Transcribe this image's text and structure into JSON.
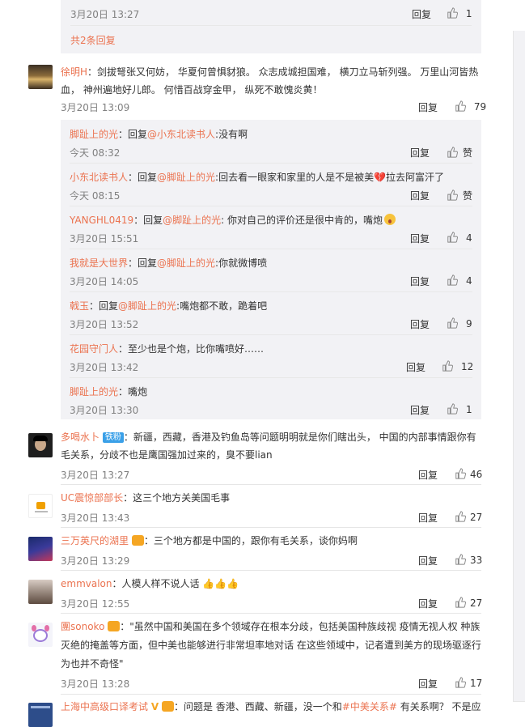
{
  "reply_label": "回复",
  "top_nested": {
    "time": "3月20日 13:27",
    "likes": "1",
    "total_replies": "共2条回复"
  },
  "comments": [
    {
      "name": "徐明H",
      "text": "：剑拔弩张又何妨， 华夏何曾惧豺狼。 众志成城担国难， 横刀立马斩列强。 万里山河皆热血， 神州遍地好儿郎。 何惜百战穿金甲， 纵死不敢愧炎黄！",
      "time": "3月20日 13:09",
      "likes": "79"
    },
    {
      "name": "多喝水卜",
      "badge": "铁粉",
      "text": "：新疆，西藏，香港及钓鱼岛等问题明明就是你们瞎出头， 中国的内部事情跟你有毛关系，分歧不也是鹰国强加过来的，臭不要lian",
      "time": "3月20日 13:27",
      "likes": "46"
    },
    {
      "name": "UC震惊部部长",
      "text": "：这三个地方关美国毛事",
      "time": "3月20日 13:43",
      "likes": "27"
    },
    {
      "name": "三万英尺的湖里",
      "text": "：三个地方都是中国的，跟你有毛关系，谈你妈啊",
      "time": "3月20日 13:29",
      "likes": "33"
    },
    {
      "name": "emmvalon",
      "text": "：人模人样不说人话",
      "time": "3月20日 12:55",
      "likes": "27"
    },
    {
      "name": "團sonoko",
      "text": "：\"虽然中国和美国在多个领域存在根本分歧，包括美国种族歧视 疫情无视人权 种族灭绝的掩盖等方面，但中美也能够进行非常坦率地对话 在这些领域中，记者遭到美方的现场驱逐行为也并不奇怪\"",
      "time": "3月20日 13:28",
      "likes": "17"
    },
    {
      "name": "上海中高级口译考试",
      "text": "：问题是 香港、西藏、新疆，没一个和",
      "hashtag": "#中美关系#",
      "tail": " 有关系啊？ 不是应"
    }
  ],
  "replies": [
    {
      "name": "脚趾上的光",
      "pre": "：回复",
      "at": "@小东北读书人",
      "text": ":没有啊",
      "time": "今天 08:32",
      "likes": "赞"
    },
    {
      "name": "小东北读书人",
      "pre": "：回复",
      "at": "@脚趾上的光",
      "text": ":回去看一眼家和家里的人是不是被美💔拉去阿富汗了",
      "time": "今天 08:15",
      "likes": "赞"
    },
    {
      "name": "YANGHL0419",
      "pre": "：回复",
      "at": "@脚趾上的光",
      "text": ": 你对自己的评价还是很中肯的，嘴炮",
      "time": "3月20日 15:51",
      "likes": "4"
    },
    {
      "name": "我就是大世界",
      "pre": "：回复",
      "at": "@脚趾上的光",
      "text": ":你就微博喷",
      "time": "3月20日 14:05",
      "likes": "4"
    },
    {
      "name": "戟玉",
      "pre": "：回复",
      "at": "@脚趾上的光",
      "text": ":嘴炮都不敢，跪着吧",
      "time": "3月20日 13:52",
      "likes": "9"
    },
    {
      "name": "花园守门人",
      "pre": "",
      "at": "",
      "text": "：至少也是个炮，比你嘴喷好……",
      "time": "3月20日 13:42",
      "likes": "12"
    },
    {
      "name": "脚趾上的光",
      "pre": "",
      "at": "",
      "text": "：嘴炮",
      "time": "3月20日 13:30",
      "likes": "1"
    }
  ]
}
